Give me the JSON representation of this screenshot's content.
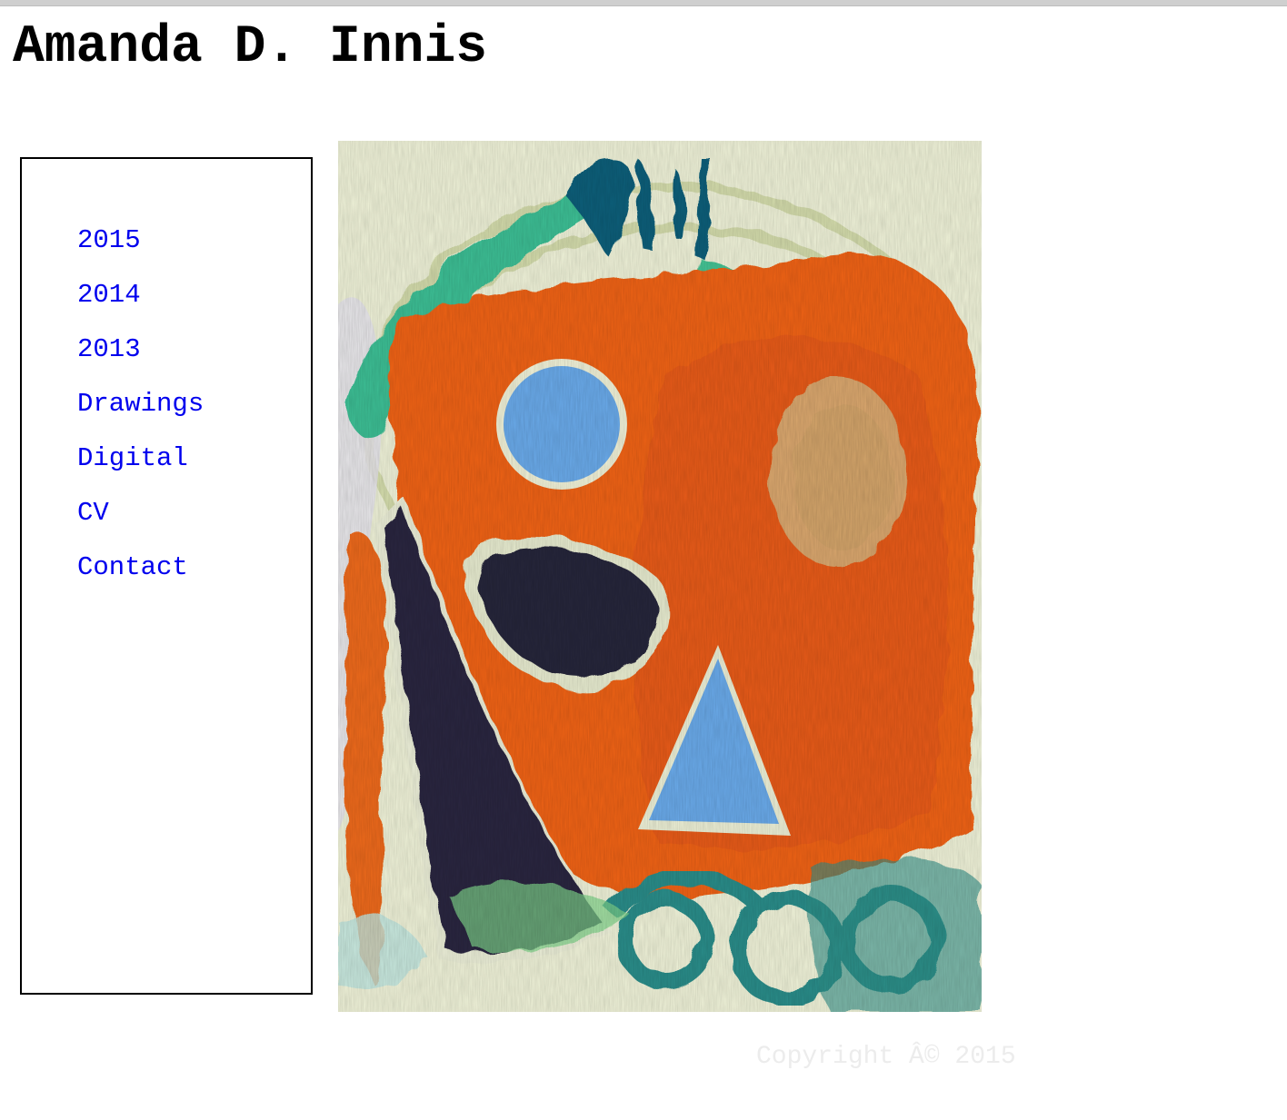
{
  "header": {
    "site_title": "Amanda D. Innis"
  },
  "nav": {
    "items": [
      {
        "label": "2015"
      },
      {
        "label": "2014"
      },
      {
        "label": "2013"
      },
      {
        "label": "Drawings"
      },
      {
        "label": "Digital"
      },
      {
        "label": "CV"
      },
      {
        "label": "Contact"
      }
    ]
  },
  "footer": {
    "copyright": "Copyright Â© 2015"
  },
  "colors": {
    "link": "#0000ee",
    "title": "#000000",
    "nav_border": "#000000",
    "copyright": "#ececec"
  }
}
